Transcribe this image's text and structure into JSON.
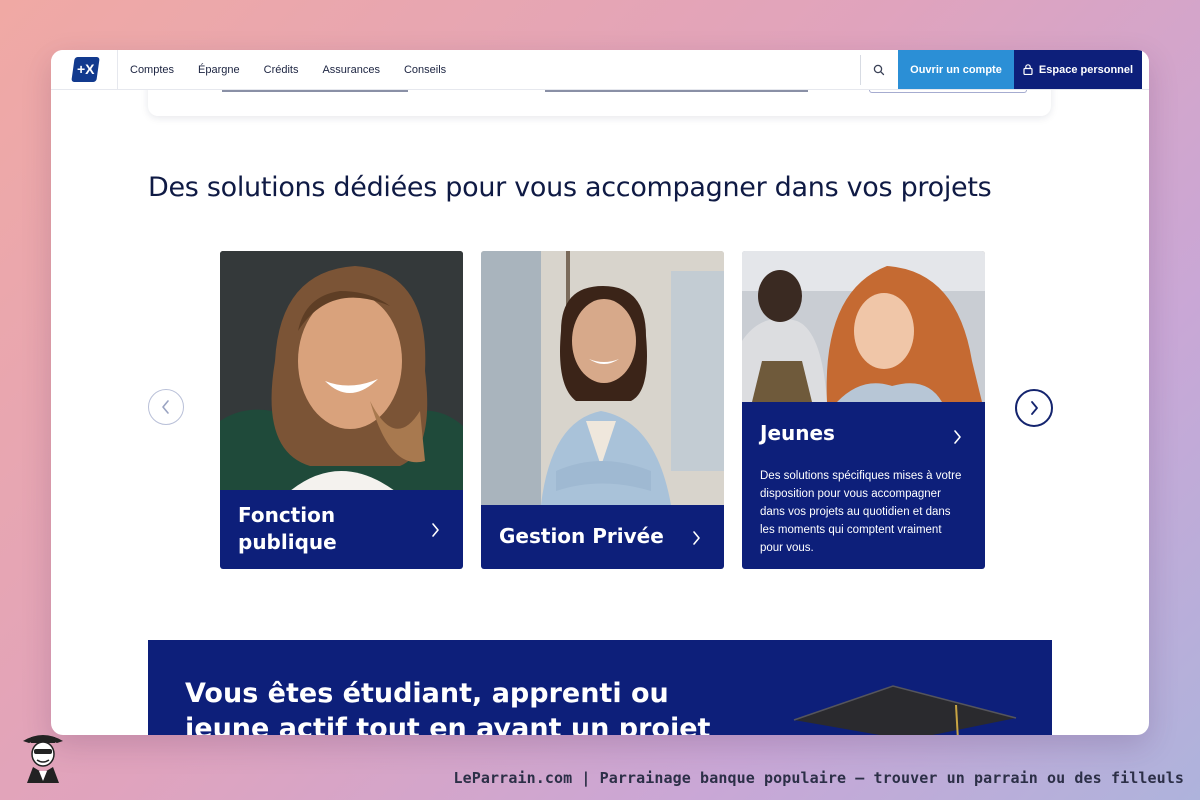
{
  "nav": {
    "logo_text": "+X",
    "menu": [
      "Comptes",
      "Épargne",
      "Crédits",
      "Assurances",
      "Conseils"
    ],
    "open_account": "Ouvrir un compte",
    "personal_space": "Espace personnel"
  },
  "section": {
    "title": "Des solutions dédiées pour vous accompagner dans vos projets"
  },
  "cards": [
    {
      "title_line1": "Fonction",
      "title_line2": "publique"
    },
    {
      "title": "Gestion Privée"
    },
    {
      "title": "Jeunes",
      "description": "Des solutions spécifiques mises à votre disposition pour vous accompagner dans vos projets au quotidien et dans les moments qui comptent vraiment pour vous."
    }
  ],
  "banner": {
    "title": "Vous êtes étudiant, apprenti ou jeune actif tout en ayant un projet"
  },
  "footer": {
    "caption": "LeParrain.com | Parrainage banque populaire — trouver un parrain ou des filleuls"
  },
  "colors": {
    "brand_dark": "#0d1f7a",
    "brand_light": "#2b8fd6",
    "heading": "#0f1a44"
  }
}
